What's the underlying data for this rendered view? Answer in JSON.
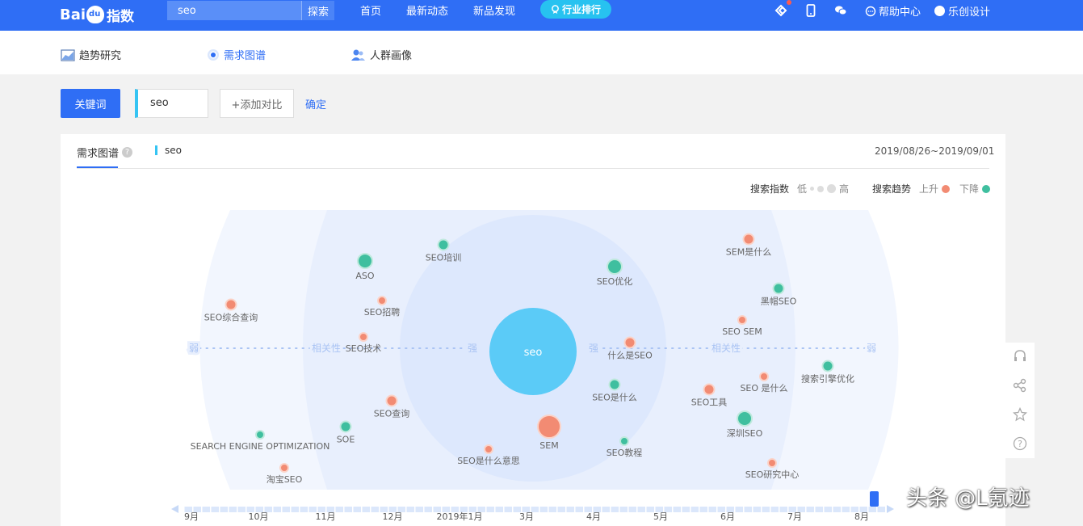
{
  "header": {
    "logo_text": "Bai",
    "logo_paw": "du",
    "logo_zs": "指数",
    "search_value": "seo",
    "search_button": "探索",
    "nav": [
      "首页",
      "最新动态",
      "新品发现"
    ],
    "rank_button": "行业排行",
    "help": "帮助中心",
    "user": "乐创设计"
  },
  "page_tabs": [
    "趋势研究",
    "需求图谱",
    "人群画像"
  ],
  "keyword_bar": {
    "keyword_button": "关键词",
    "keyword_value": "seo",
    "add_compare": "+添加对比",
    "confirm": "确定"
  },
  "panel": {
    "tab_label": "需求图谱",
    "series_tag": "seo",
    "date_range": "2019/08/26~2019/09/01",
    "legend": {
      "index_label": "搜索指数",
      "low": "低",
      "high": "高",
      "trend_label": "搜索趋势",
      "up": "上升",
      "down": "下降",
      "up_color": "#f28b73",
      "down_color": "#3fbf9f"
    },
    "axis": {
      "weak_left": "弱",
      "relevance_left": "相关性",
      "strong_left": "强",
      "strong_right": "强",
      "relevance_right": "相关性",
      "weak_right": "弱"
    },
    "center_keyword": "seo",
    "timeline": [
      "9月",
      "10月",
      "11月",
      "12月",
      "2019年1月",
      "3月",
      "4月",
      "5月",
      "6月",
      "7月",
      "8月"
    ]
  },
  "nodes": [
    {
      "label": "ASO",
      "trend": "down",
      "size": 3
    },
    {
      "label": "SEO培训",
      "trend": "down",
      "size": 2
    },
    {
      "label": "SEO优化",
      "trend": "down",
      "size": 3
    },
    {
      "label": "SEM是什么",
      "trend": "up",
      "size": 2
    },
    {
      "label": "黑帽SEO",
      "trend": "down",
      "size": 2
    },
    {
      "label": "SEO综合查询",
      "trend": "up",
      "size": 2
    },
    {
      "label": "SEO招聘",
      "trend": "up",
      "size": 1
    },
    {
      "label": "SEO SEM",
      "trend": "up",
      "size": 1
    },
    {
      "label": "SEO技术",
      "trend": "up",
      "size": 1
    },
    {
      "label": "什么是SEO",
      "trend": "up",
      "size": 2
    },
    {
      "label": "搜索引擎优化",
      "trend": "down",
      "size": 2
    },
    {
      "label": "SEO 是什么",
      "trend": "up",
      "size": 1
    },
    {
      "label": "SEO是什么",
      "trend": "down",
      "size": 2
    },
    {
      "label": "SEO工具",
      "trend": "up",
      "size": 2
    },
    {
      "label": "SEO查询",
      "trend": "up",
      "size": 2
    },
    {
      "label": "深圳SEO",
      "trend": "down",
      "size": 3
    },
    {
      "label": "SEM",
      "trend": "up",
      "size": 4
    },
    {
      "label": "SOE",
      "trend": "down",
      "size": 2
    },
    {
      "label": "SEARCH ENGINE OPTIMIZATION",
      "trend": "down",
      "size": 1
    },
    {
      "label": "SEO是什么意思",
      "trend": "up",
      "size": 1
    },
    {
      "label": "SEO教程",
      "trend": "down",
      "size": 1
    },
    {
      "label": "淘宝SEO",
      "trend": "up",
      "size": 1
    },
    {
      "label": "SEO研究中心",
      "trend": "up",
      "size": 1
    }
  ],
  "watermark": "头条 @L氪迹"
}
